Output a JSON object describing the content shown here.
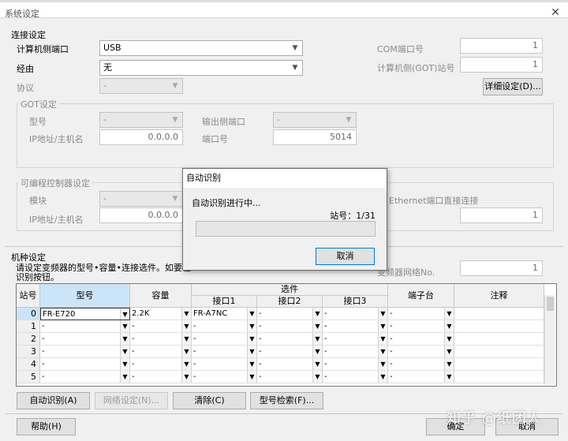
{
  "window": {
    "title": "系统设定",
    "close_glyph": "✕"
  },
  "connection": {
    "title": "连接设定",
    "pc_port_label": "计算机侧端口",
    "pc_port_value": "USB",
    "via_label": "经由",
    "via_value": "无",
    "protocol_label": "协议",
    "protocol_value": "-",
    "com_port_label": "COM端口号",
    "com_port_value": "1",
    "pc_got_station_label": "计算机侧(GOT)站号",
    "pc_got_station_value": "1",
    "detail_button": "详细设定(D)..."
  },
  "got": {
    "title": "GOT设定",
    "model_label": "型号",
    "model_value": "-",
    "output_port_label": "输出侧端口",
    "output_port_value": "-",
    "ip_label": "IP地址/主机名",
    "ip_value": "0.0.0.0",
    "port_label": "端口号",
    "port_value": "5014"
  },
  "plc": {
    "title": "可编程控制器设定",
    "module_label": "模块",
    "module_value": "-",
    "ip_label": "IP地址/主机名",
    "ip_value": "0.0.0.0",
    "ethernet_direct_label": "Ethernet端口直接连接",
    "right_value": "1"
  },
  "model_settings": {
    "title": "机种设定",
    "description_line1": "请设定变频器的型号•容量•连接选件。如要检",
    "description_line2": "识别按钮。",
    "network_no_label": "变频器网络No.",
    "network_no_value": "1"
  },
  "grid": {
    "headers": {
      "station": "站号",
      "model": "型号",
      "capacity": "容量",
      "option": "选件",
      "if1": "接口1",
      "if2": "接口2",
      "if3": "接口3",
      "terminal": "端子台",
      "note": "注释"
    },
    "rows": [
      {
        "no": "0",
        "model": "FR-E720",
        "capacity": "2.2K",
        "if1": "FR-A7NC",
        "if2": "-",
        "if3": "-",
        "terminal": "-",
        "note": ""
      },
      {
        "no": "1",
        "model": "-",
        "capacity": "-",
        "if1": "-",
        "if2": "-",
        "if3": "-",
        "terminal": "-",
        "note": ""
      },
      {
        "no": "2",
        "model": "-",
        "capacity": "-",
        "if1": "-",
        "if2": "-",
        "if3": "-",
        "terminal": "-",
        "note": ""
      },
      {
        "no": "3",
        "model": "-",
        "capacity": "-",
        "if1": "-",
        "if2": "-",
        "if3": "-",
        "terminal": "-",
        "note": ""
      },
      {
        "no": "4",
        "model": "-",
        "capacity": "-",
        "if1": "-",
        "if2": "-",
        "if3": "-",
        "terminal": "-",
        "note": ""
      },
      {
        "no": "5",
        "model": "-",
        "capacity": "-",
        "if1": "-",
        "if2": "-",
        "if3": "-",
        "terminal": "-",
        "note": ""
      }
    ]
  },
  "buttons": {
    "auto_detect": "自动识别(A)",
    "network_settings": "网络设定(N)...",
    "clear": "清除(C)",
    "model_search": "型号检索(F)...",
    "help": "帮助(H)",
    "ok": "确定",
    "cancel": "取消"
  },
  "dialog": {
    "title": "自动识别",
    "message": "自动识别进行中...",
    "station_label": "站号：1/31",
    "progress_fraction": 0,
    "cancel_button": "取消"
  },
  "watermark": "知乎 @纸团人",
  "icons": {
    "dropdown": "▼"
  }
}
